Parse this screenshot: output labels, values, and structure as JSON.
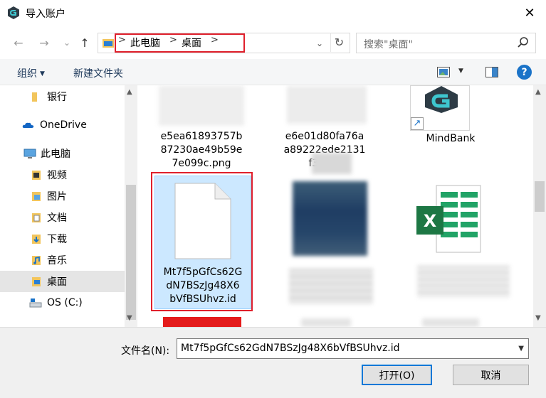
{
  "window": {
    "title": "导入账户",
    "close_glyph": "✕"
  },
  "nav": {
    "back_glyph": "←",
    "forward_glyph": "→",
    "recent_glyph": "⌄",
    "up_glyph": "↑",
    "breadcrumbs": [
      "此电脑",
      "桌面"
    ],
    "separator": ">",
    "refresh_glyph": "↻",
    "dropdown_glyph": "⌄"
  },
  "search": {
    "placeholder": "搜索\"桌面\""
  },
  "toolbar": {
    "organize_label": "组织",
    "new_folder_label": "新建文件夹",
    "help_label": "?"
  },
  "sidebar": {
    "items": [
      {
        "label": "银行",
        "icon": "folder-icon"
      },
      {
        "label": "OneDrive",
        "icon": "onedrive-icon"
      },
      {
        "label": "此电脑",
        "icon": "computer-icon"
      },
      {
        "label": "视频",
        "icon": "videos-icon"
      },
      {
        "label": "图片",
        "icon": "pictures-icon"
      },
      {
        "label": "文档",
        "icon": "documents-icon"
      },
      {
        "label": "下载",
        "icon": "downloads-icon"
      },
      {
        "label": "音乐",
        "icon": "music-icon"
      },
      {
        "label": "桌面",
        "icon": "desktop-icon",
        "selected": true
      },
      {
        "label": "OS (C:)",
        "icon": "drive-icon"
      }
    ]
  },
  "files": {
    "items": [
      {
        "name_lines": [
          "e5ea61893757b",
          "87230ae49b59e",
          "7e099c.png"
        ],
        "type": "image"
      },
      {
        "name_lines": [
          "e6e01d80fa76a",
          "a89222ede2131",
          "f374..."
        ],
        "type": "image"
      },
      {
        "name_lines": [
          "MindBank"
        ],
        "type": "shortcut"
      },
      {
        "name_lines": [
          "Mt7f5pGfCs62G",
          "dN7BSzJg48X6",
          "bVfBSUhvz.id"
        ],
        "type": "file",
        "selected": true
      },
      {
        "name_lines": [],
        "type": "blurred"
      },
      {
        "name_lines": [],
        "type": "excel"
      }
    ]
  },
  "bottom": {
    "filename_label": "文件名(N):",
    "filename_value": "Mt7f5pGfCs62GdN7BSzJg48X6bVfBSUhvz.id",
    "open_label": "打开(O)",
    "cancel_label": "取消"
  },
  "colors": {
    "accent": "#0078d7",
    "highlight": "#e0202c",
    "selection": "#cce8ff"
  }
}
